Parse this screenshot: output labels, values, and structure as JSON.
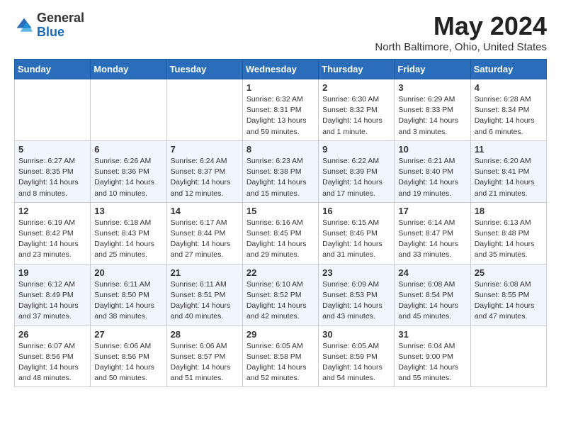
{
  "header": {
    "logo_general": "General",
    "logo_blue": "Blue",
    "title": "May 2024",
    "location": "North Baltimore, Ohio, United States"
  },
  "days_of_week": [
    "Sunday",
    "Monday",
    "Tuesday",
    "Wednesday",
    "Thursday",
    "Friday",
    "Saturday"
  ],
  "weeks": [
    [
      {
        "day": "",
        "info": ""
      },
      {
        "day": "",
        "info": ""
      },
      {
        "day": "",
        "info": ""
      },
      {
        "day": "1",
        "info": "Sunrise: 6:32 AM\nSunset: 8:31 PM\nDaylight: 13 hours and 59 minutes."
      },
      {
        "day": "2",
        "info": "Sunrise: 6:30 AM\nSunset: 8:32 PM\nDaylight: 14 hours and 1 minute."
      },
      {
        "day": "3",
        "info": "Sunrise: 6:29 AM\nSunset: 8:33 PM\nDaylight: 14 hours and 3 minutes."
      },
      {
        "day": "4",
        "info": "Sunrise: 6:28 AM\nSunset: 8:34 PM\nDaylight: 14 hours and 6 minutes."
      }
    ],
    [
      {
        "day": "5",
        "info": "Sunrise: 6:27 AM\nSunset: 8:35 PM\nDaylight: 14 hours and 8 minutes."
      },
      {
        "day": "6",
        "info": "Sunrise: 6:26 AM\nSunset: 8:36 PM\nDaylight: 14 hours and 10 minutes."
      },
      {
        "day": "7",
        "info": "Sunrise: 6:24 AM\nSunset: 8:37 PM\nDaylight: 14 hours and 12 minutes."
      },
      {
        "day": "8",
        "info": "Sunrise: 6:23 AM\nSunset: 8:38 PM\nDaylight: 14 hours and 15 minutes."
      },
      {
        "day": "9",
        "info": "Sunrise: 6:22 AM\nSunset: 8:39 PM\nDaylight: 14 hours and 17 minutes."
      },
      {
        "day": "10",
        "info": "Sunrise: 6:21 AM\nSunset: 8:40 PM\nDaylight: 14 hours and 19 minutes."
      },
      {
        "day": "11",
        "info": "Sunrise: 6:20 AM\nSunset: 8:41 PM\nDaylight: 14 hours and 21 minutes."
      }
    ],
    [
      {
        "day": "12",
        "info": "Sunrise: 6:19 AM\nSunset: 8:42 PM\nDaylight: 14 hours and 23 minutes."
      },
      {
        "day": "13",
        "info": "Sunrise: 6:18 AM\nSunset: 8:43 PM\nDaylight: 14 hours and 25 minutes."
      },
      {
        "day": "14",
        "info": "Sunrise: 6:17 AM\nSunset: 8:44 PM\nDaylight: 14 hours and 27 minutes."
      },
      {
        "day": "15",
        "info": "Sunrise: 6:16 AM\nSunset: 8:45 PM\nDaylight: 14 hours and 29 minutes."
      },
      {
        "day": "16",
        "info": "Sunrise: 6:15 AM\nSunset: 8:46 PM\nDaylight: 14 hours and 31 minutes."
      },
      {
        "day": "17",
        "info": "Sunrise: 6:14 AM\nSunset: 8:47 PM\nDaylight: 14 hours and 33 minutes."
      },
      {
        "day": "18",
        "info": "Sunrise: 6:13 AM\nSunset: 8:48 PM\nDaylight: 14 hours and 35 minutes."
      }
    ],
    [
      {
        "day": "19",
        "info": "Sunrise: 6:12 AM\nSunset: 8:49 PM\nDaylight: 14 hours and 37 minutes."
      },
      {
        "day": "20",
        "info": "Sunrise: 6:11 AM\nSunset: 8:50 PM\nDaylight: 14 hours and 38 minutes."
      },
      {
        "day": "21",
        "info": "Sunrise: 6:11 AM\nSunset: 8:51 PM\nDaylight: 14 hours and 40 minutes."
      },
      {
        "day": "22",
        "info": "Sunrise: 6:10 AM\nSunset: 8:52 PM\nDaylight: 14 hours and 42 minutes."
      },
      {
        "day": "23",
        "info": "Sunrise: 6:09 AM\nSunset: 8:53 PM\nDaylight: 14 hours and 43 minutes."
      },
      {
        "day": "24",
        "info": "Sunrise: 6:08 AM\nSunset: 8:54 PM\nDaylight: 14 hours and 45 minutes."
      },
      {
        "day": "25",
        "info": "Sunrise: 6:08 AM\nSunset: 8:55 PM\nDaylight: 14 hours and 47 minutes."
      }
    ],
    [
      {
        "day": "26",
        "info": "Sunrise: 6:07 AM\nSunset: 8:56 PM\nDaylight: 14 hours and 48 minutes."
      },
      {
        "day": "27",
        "info": "Sunrise: 6:06 AM\nSunset: 8:56 PM\nDaylight: 14 hours and 50 minutes."
      },
      {
        "day": "28",
        "info": "Sunrise: 6:06 AM\nSunset: 8:57 PM\nDaylight: 14 hours and 51 minutes."
      },
      {
        "day": "29",
        "info": "Sunrise: 6:05 AM\nSunset: 8:58 PM\nDaylight: 14 hours and 52 minutes."
      },
      {
        "day": "30",
        "info": "Sunrise: 6:05 AM\nSunset: 8:59 PM\nDaylight: 14 hours and 54 minutes."
      },
      {
        "day": "31",
        "info": "Sunrise: 6:04 AM\nSunset: 9:00 PM\nDaylight: 14 hours and 55 minutes."
      },
      {
        "day": "",
        "info": ""
      }
    ]
  ]
}
